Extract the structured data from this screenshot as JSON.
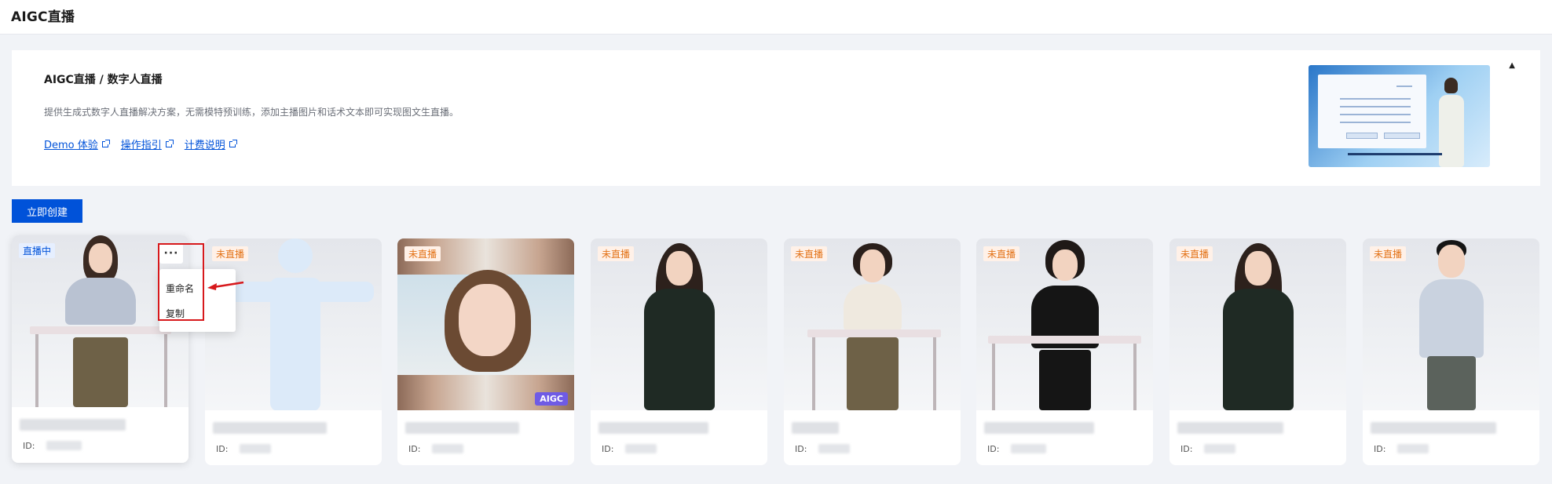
{
  "header": {
    "title": "AIGC直播"
  },
  "intro": {
    "heading": "AIGC直播 / 数字人直播",
    "description": "提供生成式数字人直播解决方案，无需模特预训练，添加主播图片和话术文本即可实现图文生直播。",
    "links": [
      "Demo 体验",
      "操作指引",
      "计费说明"
    ],
    "collapse_icon": "▲"
  },
  "toolbar": {
    "create_label": "立即创建"
  },
  "cards": [
    {
      "status": "直播中",
      "status_type": "live",
      "id_label": "ID:"
    },
    {
      "status": "未直播",
      "status_type": "off",
      "id_label": "ID:"
    },
    {
      "status": "未直播",
      "status_type": "off",
      "id_label": "ID:",
      "tag": "AIGC"
    },
    {
      "status": "未直播",
      "status_type": "off",
      "id_label": "ID:"
    },
    {
      "status": "未直播",
      "status_type": "off",
      "id_label": "ID:"
    },
    {
      "status": "未直播",
      "status_type": "off",
      "id_label": "ID:"
    },
    {
      "status": "未直播",
      "status_type": "off",
      "id_label": "ID:"
    },
    {
      "status": "未直播",
      "status_type": "off",
      "id_label": "ID:"
    }
  ],
  "context_menu": {
    "trigger": "···",
    "items": [
      "重命名",
      "复制"
    ]
  },
  "colors": {
    "accent": "#0052d9",
    "live_badge": "#0052d9",
    "off_badge": "#e37318",
    "highlight": "#d7191c",
    "aigc_tag": "#6f5be5"
  }
}
